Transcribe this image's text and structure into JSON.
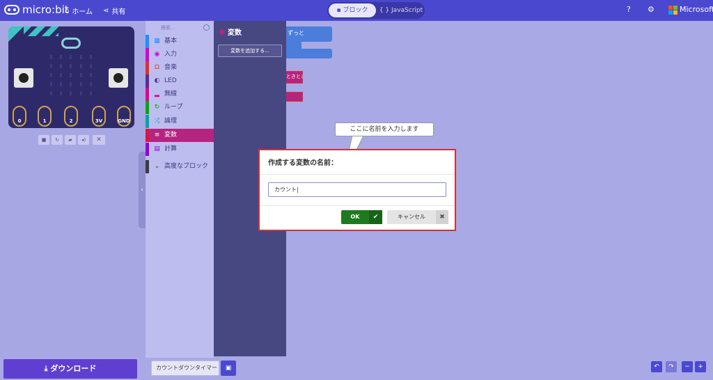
{
  "app": {
    "brand": "micro:bit",
    "nav_home": "ホーム",
    "nav_share": "共有",
    "mode_blocks": "ブロック",
    "mode_js": "JavaScript",
    "microsoft": "Microsoft"
  },
  "simulator": {
    "pins": [
      "0",
      "1",
      "2",
      "3V",
      "GND"
    ]
  },
  "toolbox": {
    "search_placeholder": "検索...",
    "categories": [
      {
        "label": "基本",
        "color": "#1e90ff",
        "icon": "grid-icon"
      },
      {
        "label": "入力",
        "color": "#d400d4",
        "icon": "target-icon"
      },
      {
        "label": "音楽",
        "color": "#e63022",
        "icon": "headphones-icon"
      },
      {
        "label": "LED",
        "color": "#5c2d91",
        "icon": "toggle-icon"
      },
      {
        "label": "無線",
        "color": "#e3008c",
        "icon": "signal-icon"
      },
      {
        "label": "ループ",
        "color": "#00aa00",
        "icon": "loop-icon"
      },
      {
        "label": "論理",
        "color": "#00a4a6",
        "icon": "shuffle-icon"
      },
      {
        "label": "変数",
        "color": "#dc143c",
        "icon": "list-icon"
      },
      {
        "label": "計算",
        "color": "#9400d3",
        "icon": "calculator-icon"
      },
      {
        "label": "高度なブロック",
        "color": "#3c3c3c",
        "icon": "chevron-down-icon"
      }
    ]
  },
  "flyout": {
    "title": "変数",
    "add_variable": "変数を追加する..."
  },
  "workspace": {
    "block_forever": "ずっと",
    "block_event": "ときとき"
  },
  "dialog": {
    "title": "作成する変数の名前：",
    "input_value": "カウント|",
    "ok": "OK",
    "cancel": "キャンセル"
  },
  "callout": "ここに名前を入力します",
  "bottom": {
    "download": "ダウンロード",
    "project_name": "カウントダウンタイマー"
  }
}
